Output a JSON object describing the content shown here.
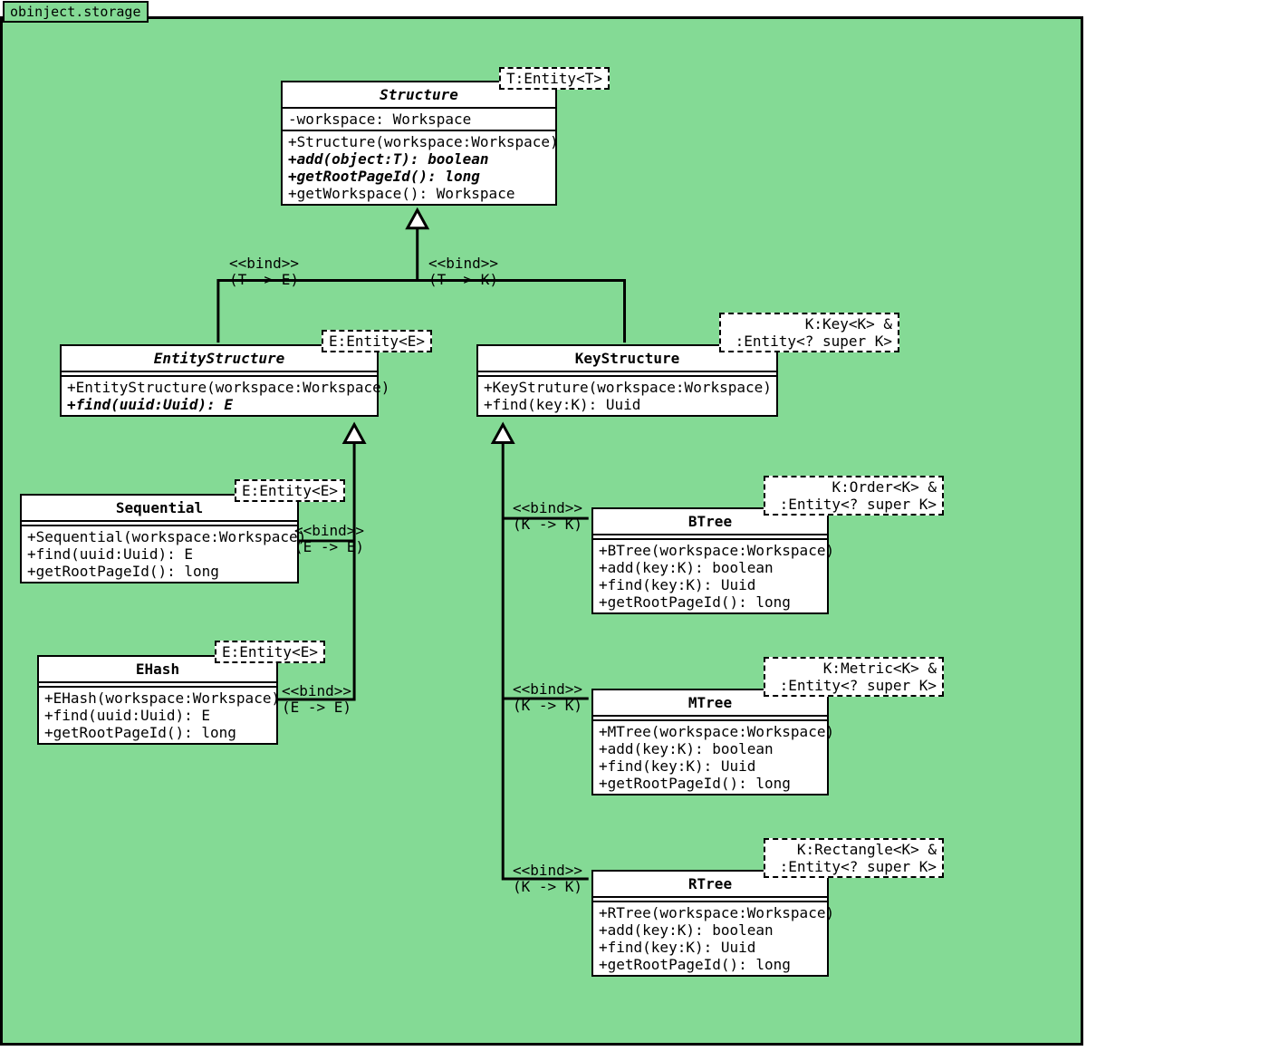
{
  "package": {
    "name": "obinject.storage"
  },
  "chart_data": {
    "type": "uml-class-diagram",
    "package": "obinject.storage",
    "classes": [
      {
        "name": "Structure",
        "abstract": true,
        "typeParams": "T:Entity<T>",
        "attributes": [
          "-workspace: Workspace"
        ],
        "operations": [
          {
            "sig": "+Structure(workspace:Workspace)"
          },
          {
            "sig": "+add(object:T): boolean",
            "abstract": true
          },
          {
            "sig": "+getRootPageId(): long",
            "abstract": true
          },
          {
            "sig": "+getWorkspace(): Workspace"
          }
        ]
      },
      {
        "name": "EntityStructure",
        "abstract": true,
        "typeParams": "E:Entity<E>",
        "operations": [
          {
            "sig": "+EntityStructure(workspace:Workspace)"
          },
          {
            "sig": "+find(uuid:Uuid): E",
            "abstract": true
          }
        ]
      },
      {
        "name": "KeyStructure",
        "typeParams": "K:Key<K> &\n :Entity<? super K>",
        "operations": [
          {
            "sig": "+KeyStruture(workspace:Workspace)"
          },
          {
            "sig": "+find(key:K): Uuid"
          }
        ]
      },
      {
        "name": "Sequential",
        "typeParams": "E:Entity<E>",
        "operations": [
          {
            "sig": "+Sequential(workspace:Workspace)"
          },
          {
            "sig": "+find(uuid:Uuid): E"
          },
          {
            "sig": "+getRootPageId(): long"
          }
        ]
      },
      {
        "name": "EHash",
        "typeParams": "E:Entity<E>",
        "operations": [
          {
            "sig": "+EHash(workspace:Workspace)"
          },
          {
            "sig": "+find(uuid:Uuid): E"
          },
          {
            "sig": "+getRootPageId(): long"
          }
        ]
      },
      {
        "name": "BTree",
        "typeParams": "K:Order<K> &\n :Entity<? super K>",
        "operations": [
          {
            "sig": "+BTree(workspace:Workspace)"
          },
          {
            "sig": "+add(key:K): boolean"
          },
          {
            "sig": "+find(key:K): Uuid"
          },
          {
            "sig": "+getRootPageId(): long"
          }
        ]
      },
      {
        "name": "MTree",
        "typeParams": "K:Metric<K> &\n :Entity<? super K>",
        "operations": [
          {
            "sig": "+MTree(workspace:Workspace)"
          },
          {
            "sig": "+add(key:K): boolean"
          },
          {
            "sig": "+find(key:K): Uuid"
          },
          {
            "sig": "+getRootPageId(): long"
          }
        ]
      },
      {
        "name": "RTree",
        "typeParams": "K:Rectangle<K> &\n :Entity<? super K>",
        "operations": [
          {
            "sig": "+RTree(workspace:Workspace)"
          },
          {
            "sig": "+add(key:K): boolean"
          },
          {
            "sig": "+find(key:K): Uuid"
          },
          {
            "sig": "+getRootPageId(): long"
          }
        ]
      }
    ],
    "relations": [
      {
        "from": "EntityStructure",
        "to": "Structure",
        "type": "generalization",
        "stereotype": "<<bind>>",
        "binding": "(T -> E)"
      },
      {
        "from": "KeyStructure",
        "to": "Structure",
        "type": "generalization",
        "stereotype": "<<bind>>",
        "binding": "(T -> K)"
      },
      {
        "from": "Sequential",
        "to": "EntityStructure",
        "type": "generalization",
        "stereotype": "<<bind>>",
        "binding": "(E -> E)"
      },
      {
        "from": "EHash",
        "to": "EntityStructure",
        "type": "generalization",
        "stereotype": "<<bind>>",
        "binding": "(E -> E)"
      },
      {
        "from": "BTree",
        "to": "KeyStructure",
        "type": "generalization",
        "stereotype": "<<bind>>",
        "binding": "(K -> K)"
      },
      {
        "from": "MTree",
        "to": "KeyStructure",
        "type": "generalization",
        "stereotype": "<<bind>>",
        "binding": "(K -> K)"
      },
      {
        "from": "RTree",
        "to": "KeyStructure",
        "type": "generalization",
        "stereotype": "<<bind>>",
        "binding": "(K -> K)"
      }
    ]
  },
  "labels": {
    "bind": "<<bind>>",
    "TE": "(T -> E)",
    "TK": "(T -> K)",
    "EE": "(E -> E)",
    "KK": "(K -> K)"
  }
}
